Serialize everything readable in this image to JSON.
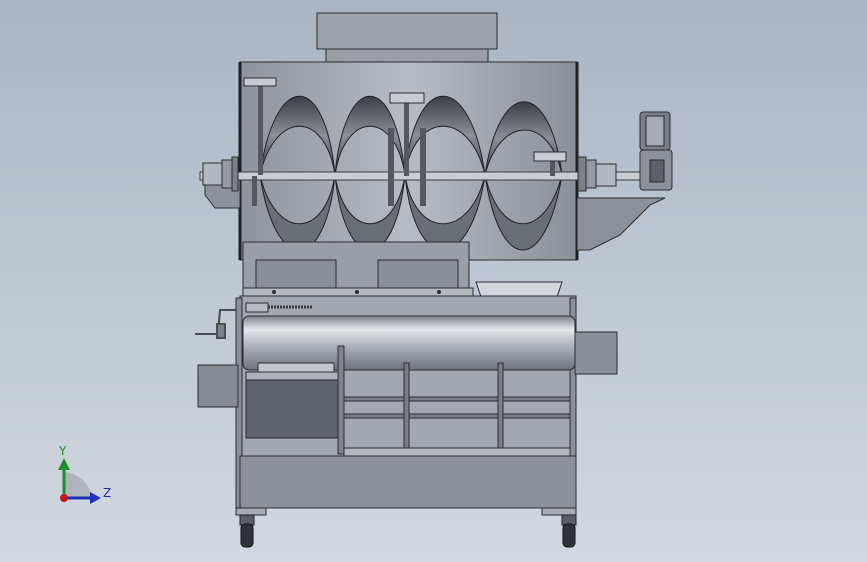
{
  "viewport": {
    "background_top": "#a9b4c3",
    "background_bottom": "#d2d8e0"
  },
  "model": {
    "metal_color": "#a0a3ab",
    "dark_metal_color": "#5c5f66",
    "edge_color": "#2b2d31"
  },
  "triad": {
    "y_label": "Y",
    "z_label": "Z",
    "y_color": "#1b8f2b",
    "z_color": "#1f2fb8",
    "x_color": "#c01515"
  }
}
